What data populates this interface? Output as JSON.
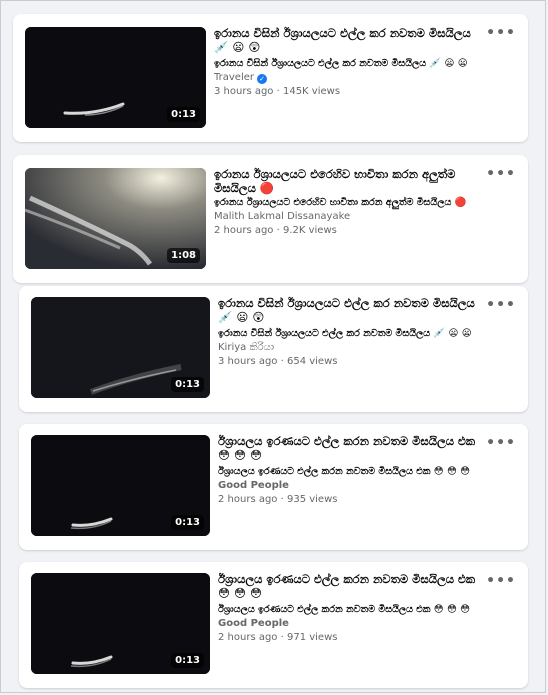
{
  "videos": [
    {
      "title": "ඉරානය විසින් ඊශ්‍රායලයට එල්ල කර නවතම මිසයිලය 💉 😦 😲",
      "subtitle": "ඉරානය විසින් ඊශ්‍රායලයට එල්ල කර නවතම මිසයිලය 💉 😦 😦",
      "channel": "Traveler",
      "verified": true,
      "meta": "3 hours ago · 145K views",
      "duration": "0:13"
    },
    {
      "title": "ඉරානය ඊශ්‍රායලයට එරෙහිව භාවිතා කරන අලුත්ම මිසයිලය 🔴",
      "subtitle": "ඉරානය ඊශ්‍රායලයට එරෙහිව භාවිතා කරන අලුත්ම මිසයිලය 🔴",
      "channel": "Malith Lakmal Dissanayake",
      "verified": false,
      "meta": "2 hours ago · 9.2K views",
      "duration": "1:08"
    },
    {
      "title": "ඉරානය විසින් ඊශ්‍රායලයට එල්ල කර නවතම මිසයිලය 💉 😦 😲",
      "subtitle": "ඉරානය විසින් ඊශ්‍රායලයට එල්ල කර නවතම මිසයිලය 💉 😦 😦",
      "channel": "Kiriya කිරියා",
      "verified": false,
      "meta": "3 hours ago · 654 views",
      "duration": "0:13"
    },
    {
      "title": "ඊශ්‍රායලය ඉරණයට එල්ල කරන නවතම මිසයිලය එක 😳 😳 😳",
      "subtitle": "ඊශ්‍රායලය ඉරණයට එල්ල කරන නවතම මිසයිලය එක 😳 😳 😳",
      "channel": "Good People",
      "verified": false,
      "meta": "2 hours ago · 935 views",
      "duration": "0:13"
    },
    {
      "title": "ඊශ්‍රායලය ඉරණයට එල්ල කරන නවතම මිසයිලය එක 😳 😳 😳",
      "subtitle": "ඊශ්‍රායලය ඉරණයට එල්ල කරන නවතම මිසයිලය එක 😳 😳 😳",
      "channel": "Good People",
      "verified": false,
      "meta": "2 hours ago · 971 views",
      "duration": "0:13"
    }
  ],
  "more_label": "•••",
  "verified_mark": "✓"
}
